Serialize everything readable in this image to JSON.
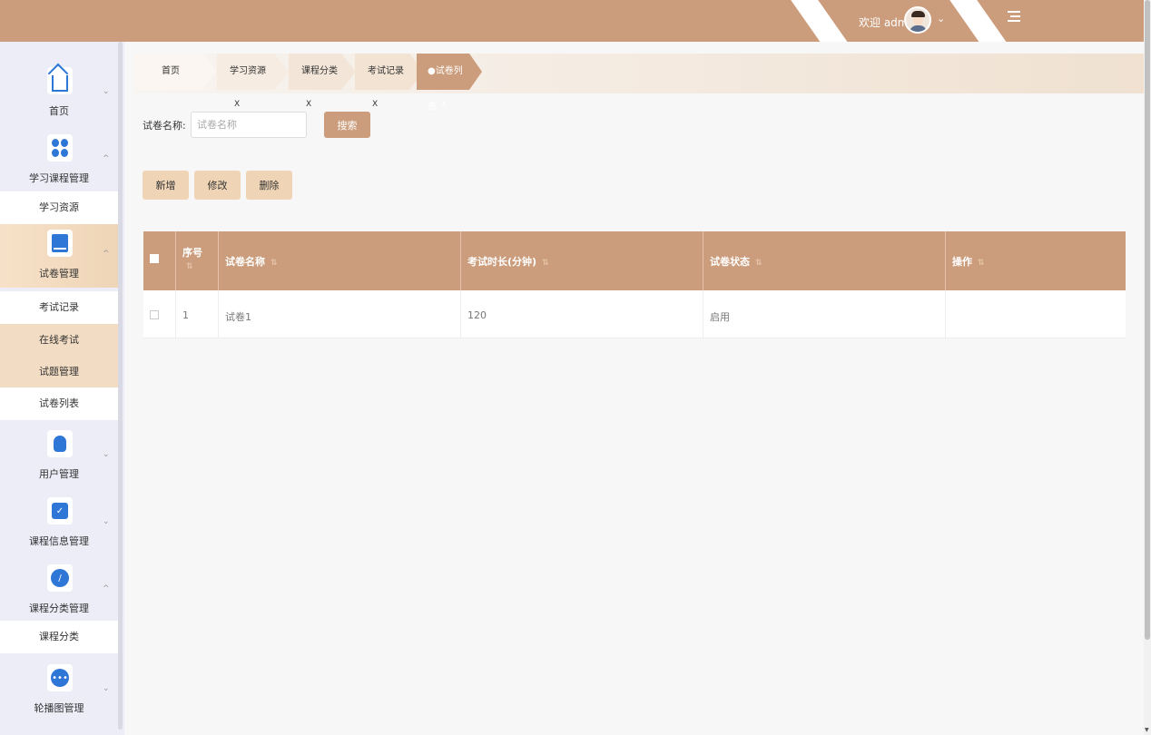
{
  "header": {
    "welcome": "欢迎 admin",
    "colors": {
      "primary": "#cc9d7c",
      "light": "#efd5b6"
    }
  },
  "sidebar": {
    "menus": [
      {
        "label": "首页",
        "icon": "home-icon"
      },
      {
        "label": "学习课程管理",
        "icon": "grid-icon",
        "subs": [
          "学习资源"
        ]
      },
      {
        "label": "试卷管理",
        "icon": "paper-icon",
        "subs": [
          "考试记录",
          "在线考试",
          "试题管理",
          "试卷列表"
        ]
      },
      {
        "label": "用户管理",
        "icon": "user-icon"
      },
      {
        "label": "课程信息管理",
        "icon": "course-info-icon"
      },
      {
        "label": "课程分类管理",
        "icon": "category-icon",
        "subs": [
          "课程分类"
        ]
      },
      {
        "label": "轮播图管理",
        "icon": "carousel-icon"
      }
    ]
  },
  "tabs": [
    {
      "label": "首页",
      "closable": false
    },
    {
      "label": "学习资源",
      "closable": true
    },
    {
      "label": "课程分类",
      "closable": true
    },
    {
      "label": "考试记录",
      "closable": true
    },
    {
      "label": "●试卷列表",
      "closable": true,
      "active": true
    }
  ],
  "tab_close": "X",
  "search": {
    "label": "试卷名称:",
    "placeholder": "试卷名称",
    "button": "搜索"
  },
  "actions": {
    "add": "新增",
    "edit": "修改",
    "delete": "删除"
  },
  "table": {
    "columns": [
      "序号",
      "试卷名称",
      "考试时长(分钟)",
      "试卷状态",
      "操作"
    ],
    "rows": [
      {
        "index": "1",
        "name": "试卷1",
        "duration": "120",
        "status": "启用",
        "ops": ""
      }
    ]
  }
}
